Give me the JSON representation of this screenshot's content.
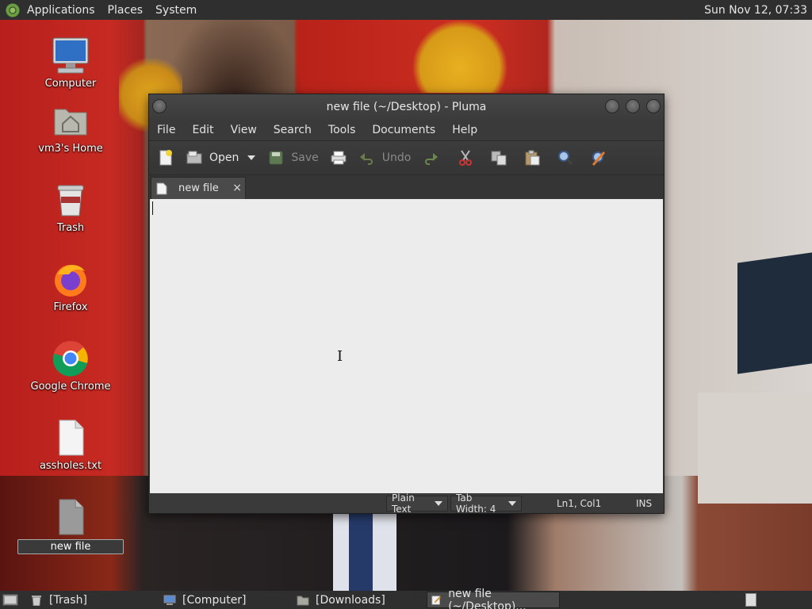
{
  "top_panel": {
    "menus": [
      "Applications",
      "Places",
      "System"
    ],
    "clock": "Sun Nov 12, 07:33"
  },
  "desktop_icons": [
    {
      "label": "Computer",
      "icon": "computer-icon"
    },
    {
      "label": "vm3's Home",
      "icon": "home-folder-icon"
    },
    {
      "label": "Trash",
      "icon": "trash-icon"
    },
    {
      "label": "Firefox",
      "icon": "firefox-icon"
    },
    {
      "label": "Google Chrome",
      "icon": "chrome-icon"
    },
    {
      "label": "assholes.txt",
      "icon": "text-file-icon"
    },
    {
      "label": "new file",
      "icon": "blank-file-icon"
    }
  ],
  "window": {
    "title": "new file (~/Desktop) - Pluma",
    "menubar": [
      "File",
      "Edit",
      "View",
      "Search",
      "Tools",
      "Documents",
      "Help"
    ],
    "toolbar": {
      "open_label": "Open",
      "save_label": "Save",
      "undo_label": "Undo"
    },
    "tab_label": "new file",
    "tab_close": "×",
    "editor_text": "",
    "status": {
      "language": "Plain Text",
      "tab_width": "Tab Width:  4",
      "position": "Ln1, Col1",
      "mode": "INS"
    }
  },
  "taskbar": {
    "items": [
      "[Trash]",
      "[Computer]",
      "[Downloads]",
      "new file (~/Desktop)..."
    ]
  },
  "colors": {
    "panel": "#2f2f2f",
    "window": "#3a3a3a",
    "editor_bg": "#ececec"
  }
}
